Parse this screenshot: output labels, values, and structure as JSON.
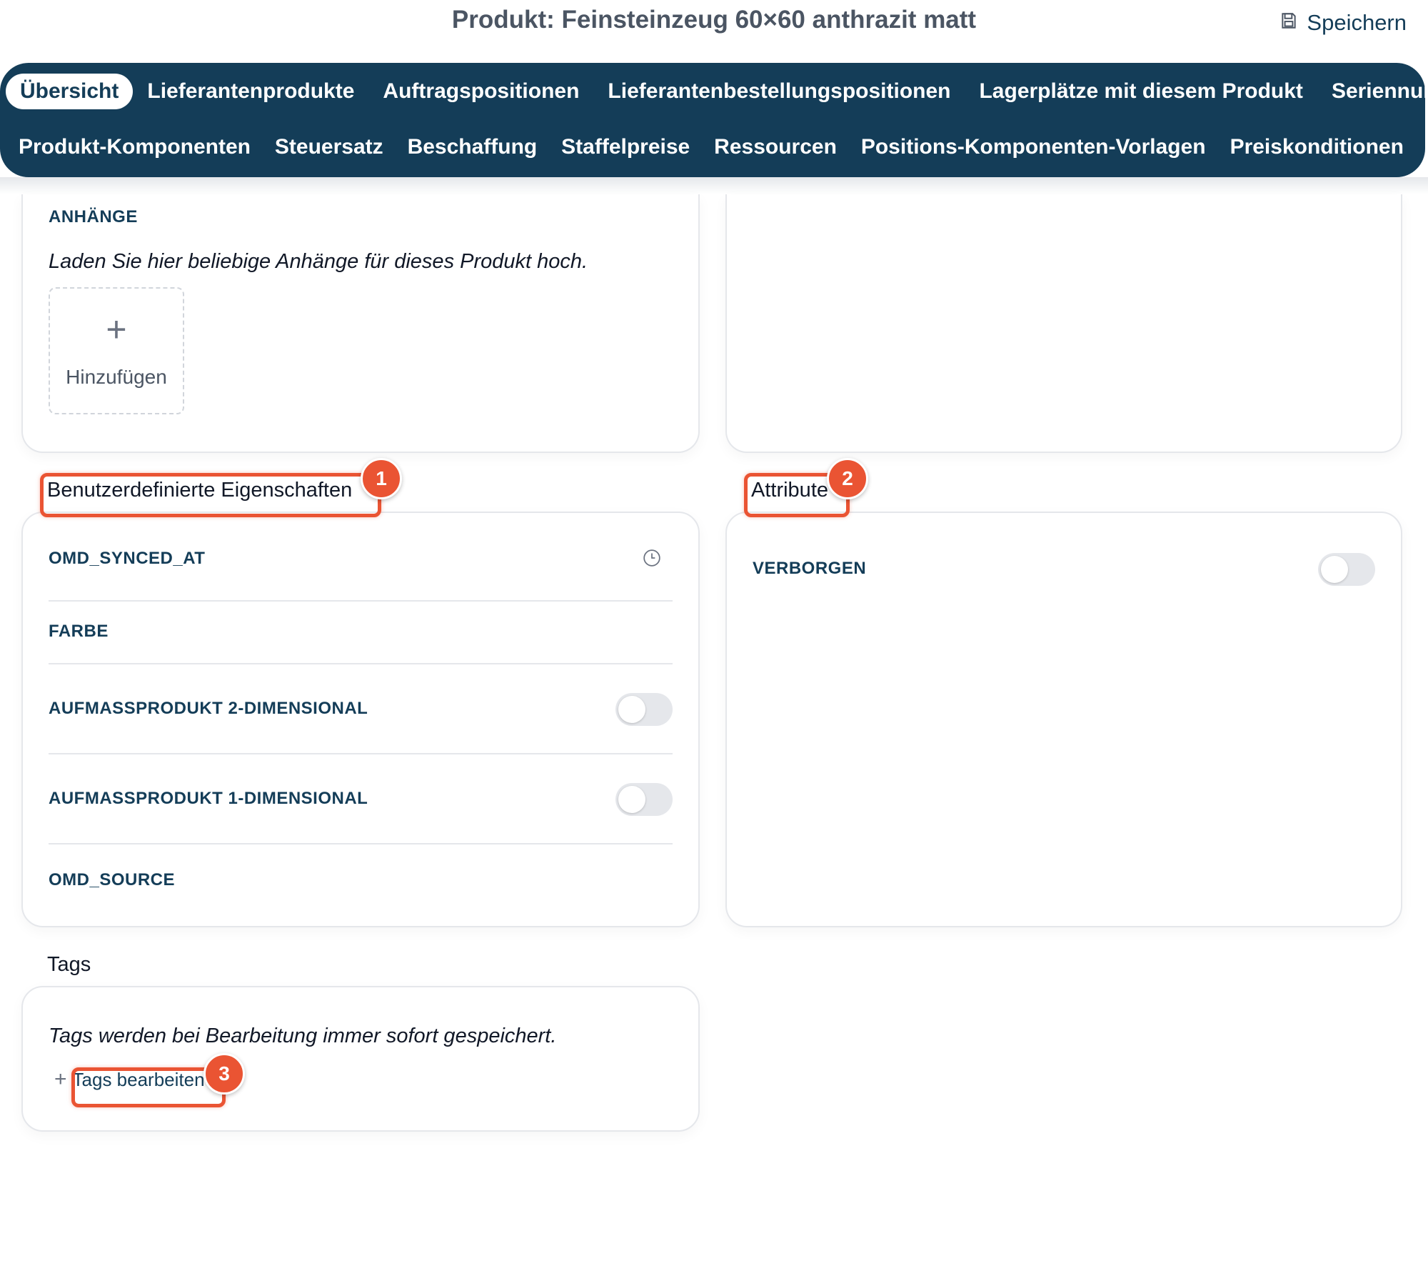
{
  "header": {
    "title": "Produkt: Feinsteinzeug 60×60 anthrazit matt",
    "save_label": "Speichern"
  },
  "nav": {
    "row1": [
      {
        "label": "Übersicht",
        "active": true
      },
      {
        "label": "Lieferantenprodukte"
      },
      {
        "label": "Auftragspositionen"
      },
      {
        "label": "Lieferantenbestellungspositionen"
      },
      {
        "label": "Lagerplätze mit diesem Produkt"
      },
      {
        "label": "Seriennummern"
      }
    ],
    "row2": [
      {
        "label": "Produkt-Komponenten"
      },
      {
        "label": "Steuersatz"
      },
      {
        "label": "Beschaffung"
      },
      {
        "label": "Staffelpreise"
      },
      {
        "label": "Ressourcen"
      },
      {
        "label": "Positions-Komponenten-Vorlagen"
      },
      {
        "label": "Preiskonditionen"
      }
    ]
  },
  "attachments": {
    "heading": "ANHÄNGE",
    "hint": "Laden Sie hier beliebige Anhänge für dieses Produkt hoch.",
    "add_label": "Hinzufügen"
  },
  "custom_properties": {
    "title": "Benutzerdefinierte Eigenschaften",
    "items": [
      {
        "label": "OMD_SYNCED_AT",
        "icon": "clock-icon"
      },
      {
        "label": "FARBE"
      },
      {
        "label": "AUFMASSPRODUKT 2-DIMENSIONAL",
        "toggle": false
      },
      {
        "label": "AUFMASSPRODUKT 1-DIMENSIONAL",
        "toggle": false
      },
      {
        "label": "OMD_SOURCE"
      }
    ]
  },
  "attributes": {
    "title": "Attribute",
    "items": [
      {
        "label": "VERBORGEN",
        "toggle": false
      }
    ]
  },
  "tags": {
    "title": "Tags",
    "hint": "Tags werden bei Bearbeitung immer sofort gespeichert.",
    "edit_label": "Tags bearbeiten"
  },
  "annotations": [
    "1",
    "2",
    "3"
  ],
  "colors": {
    "nav_bg": "#143d58",
    "accent": "#ea5433",
    "label": "#143d58"
  }
}
